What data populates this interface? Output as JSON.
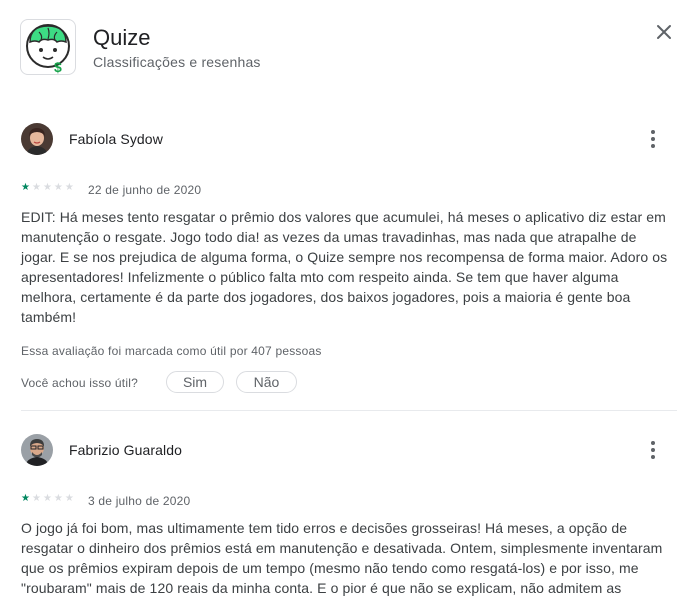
{
  "app": {
    "title": "Quize",
    "subtitle": "Classificações e resenhas",
    "icon": "quize-brain-money-icon"
  },
  "close_icon": "close-icon",
  "reviews": [
    {
      "author": "Fabíola Sydow",
      "rating": 1,
      "max_rating": 5,
      "date": "22 de junho de 2020",
      "text": "EDIT: Há meses tento resgatar o prêmio dos valores que acumulei, há meses o aplicativo diz estar em manutenção o resgate. Jogo todo dia! as vezes da umas travadinhas, mas nada que atrapalhe de jogar. E se nos prejudica de alguma forma, o Quize sempre nos recompensa de forma maior. Adoro os apresentadores! Infelizmente o público falta mto com respeito ainda. Se tem que haver alguma melhora, certamente é da parte dos jogadores, dos baixos jogadores, pois a maioria é gente boa também!",
      "helpful_count_text": "Essa avaliação foi marcada como útil por 407 pessoas",
      "helpful_question": "Você achou isso útil?",
      "yes_label": "Sim",
      "no_label": "Não"
    },
    {
      "author": "Fabrizio Guaraldo",
      "rating": 1,
      "max_rating": 5,
      "date": "3 de julho de 2020",
      "text": "O jogo já foi bom, mas ultimamente tem tido erros e decisões grosseiras! Há meses, a opção de resgatar o dinheiro dos prêmios está em manutenção e desativada. Ontem, simplesmente inventaram que os prêmios expiram depois de um tempo (mesmo não tendo como resgatá-los) e por isso, me \"roubaram\" mais de 120 reais da minha conta. E o pior é que não se explicam, não admitem as"
    }
  ]
}
